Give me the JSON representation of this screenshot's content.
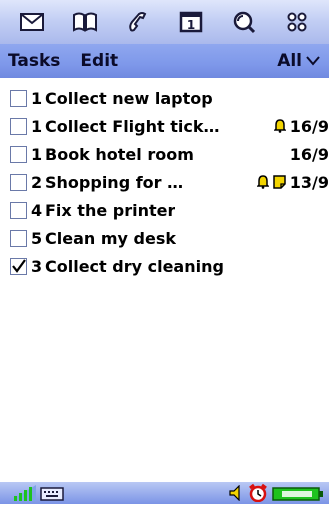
{
  "launcher": {
    "icons": [
      "mail-icon",
      "contacts-book-icon",
      "phone-icon",
      "calendar-icon",
      "search-icon",
      "apps-grid-icon"
    ],
    "calendar_day": "1"
  },
  "menubar": {
    "tasks_label": "Tasks",
    "edit_label": "Edit",
    "filter_label": "All"
  },
  "tasks": [
    {
      "priority": "1",
      "title": "Collect new laptop",
      "checked": false,
      "alarm": false,
      "note": false,
      "date": ""
    },
    {
      "priority": "1",
      "title": "Collect Flight tick…",
      "checked": false,
      "alarm": true,
      "note": false,
      "date": "16/9"
    },
    {
      "priority": "1",
      "title": "Book hotel room",
      "checked": false,
      "alarm": false,
      "note": false,
      "date": "16/9"
    },
    {
      "priority": "2",
      "title": "Shopping for …",
      "checked": false,
      "alarm": true,
      "note": true,
      "date": "13/9"
    },
    {
      "priority": "4",
      "title": "Fix the printer",
      "checked": false,
      "alarm": false,
      "note": false,
      "date": ""
    },
    {
      "priority": "5",
      "title": "Clean my desk",
      "checked": false,
      "alarm": false,
      "note": false,
      "date": ""
    },
    {
      "priority": "3",
      "title": "Collect dry cleaning",
      "checked": true,
      "alarm": false,
      "note": false,
      "date": ""
    }
  ],
  "statusbar": {
    "icons": [
      "signal-strength-icon",
      "keyboard-icon",
      "speaker-icon",
      "alarm-clock-icon",
      "battery-icon"
    ]
  },
  "colors": {
    "launcher_bg": "#c3cff4",
    "menubar_bg": "#7e98ea",
    "text": "#000000",
    "checkbox_border": "#6a79a8",
    "bell": "#f2d400"
  }
}
